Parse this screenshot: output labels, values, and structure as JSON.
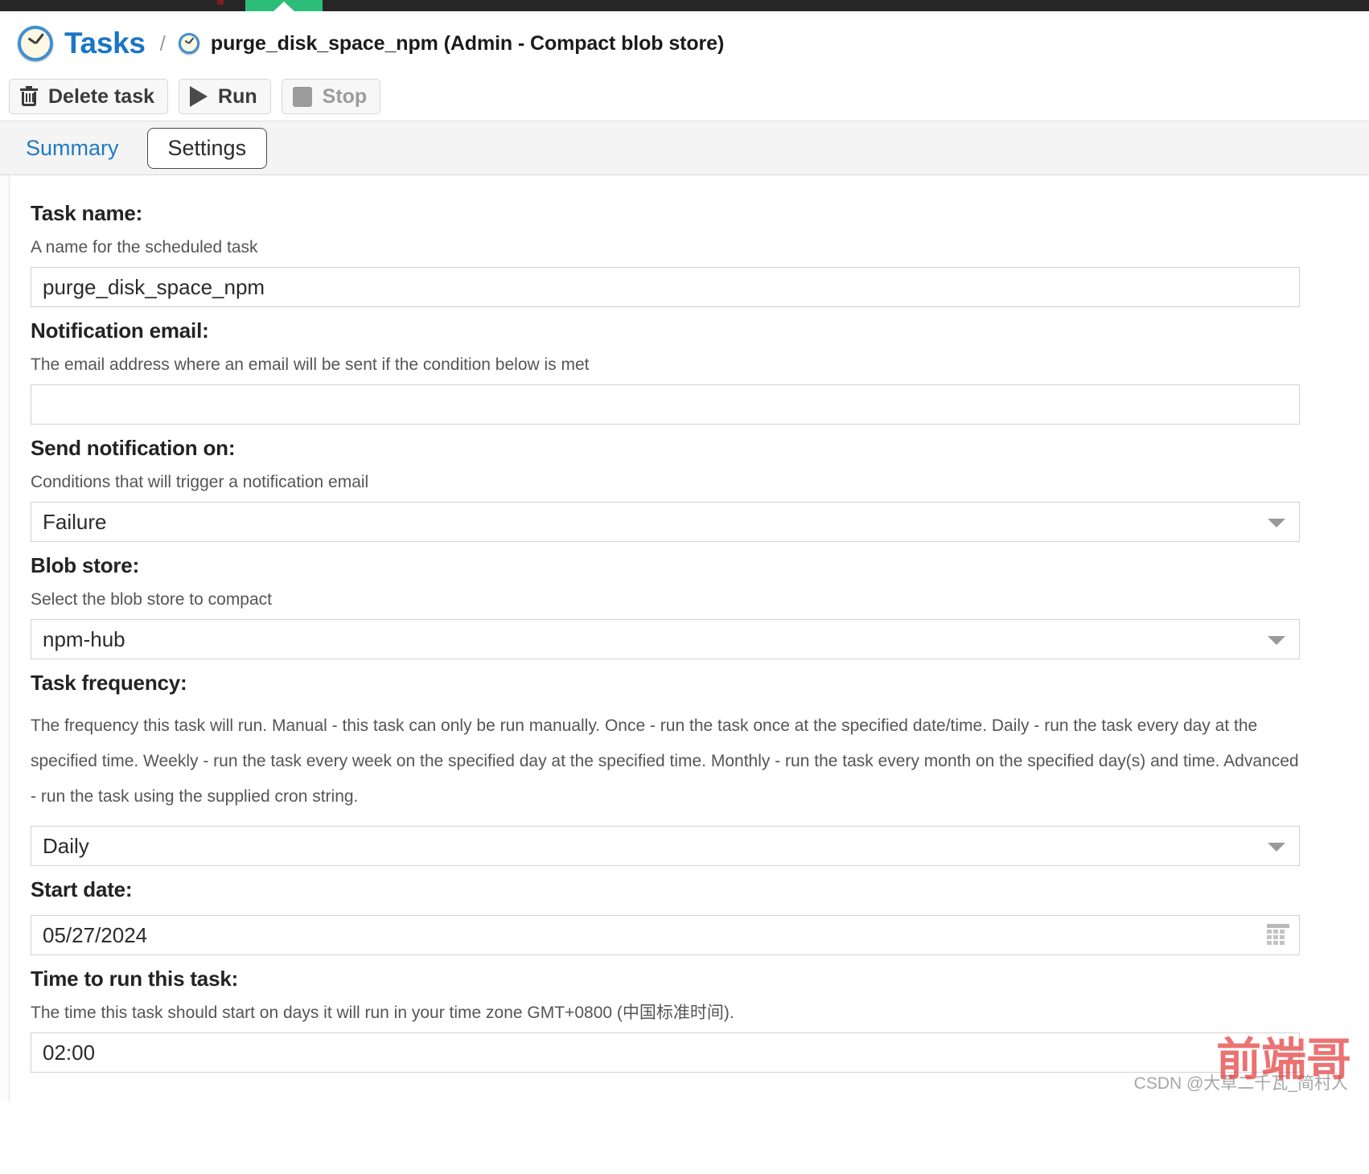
{
  "window": {
    "accent_green": "#2cbe78",
    "top_bar_color": "#262626"
  },
  "breadcrumb": {
    "root_icon": "clock-icon",
    "root_label": "Tasks",
    "separator": "/",
    "leaf_icon": "clock-icon",
    "leaf_label": "purge_disk_space_npm (Admin - Compact blob store)"
  },
  "toolbar": {
    "delete_label": "Delete task",
    "delete_icon": "trash-icon",
    "run_label": "Run",
    "run_icon": "play-icon",
    "stop_label": "Stop",
    "stop_icon": "stop-icon"
  },
  "tabs": [
    {
      "label": "Summary",
      "active": false
    },
    {
      "label": "Settings",
      "active": true
    }
  ],
  "form": {
    "task_name": {
      "label": "Task name:",
      "help": "A name for the scheduled task",
      "value": "purge_disk_space_npm",
      "placeholder": ""
    },
    "notification_email": {
      "label": "Notification email:",
      "help": "The email address where an email will be sent if the condition below is met",
      "value": "",
      "placeholder": ""
    },
    "send_notification_on": {
      "label": "Send notification on:",
      "help": "Conditions that will trigger a notification email",
      "value": "Failure"
    },
    "blob_store": {
      "label": "Blob store:",
      "help": "Select the blob store to compact",
      "value": "npm-hub"
    },
    "task_frequency": {
      "label": "Task frequency:",
      "help": "The frequency this task will run. Manual - this task can only be run manually. Once - run the task once at the specified date/time. Daily - run the task every day at the specified time. Weekly - run the task every week on the specified day at the specified time. Monthly - run the task every month on the specified day(s) and time. Advanced - run the task using the supplied cron string.",
      "value": "Daily"
    },
    "start_date": {
      "label": "Start date:",
      "help": "",
      "value": "05/27/2024",
      "icon": "calendar-icon"
    },
    "time_to_run": {
      "label": "Time to run this task:",
      "help": "The time this task should start on days it will run in your time zone GMT+0800 (中国标准时间).",
      "value": "02:00"
    }
  },
  "watermark": {
    "red_text": "前端哥",
    "gray_text": "CSDN @大草二千瓦_简村人"
  }
}
